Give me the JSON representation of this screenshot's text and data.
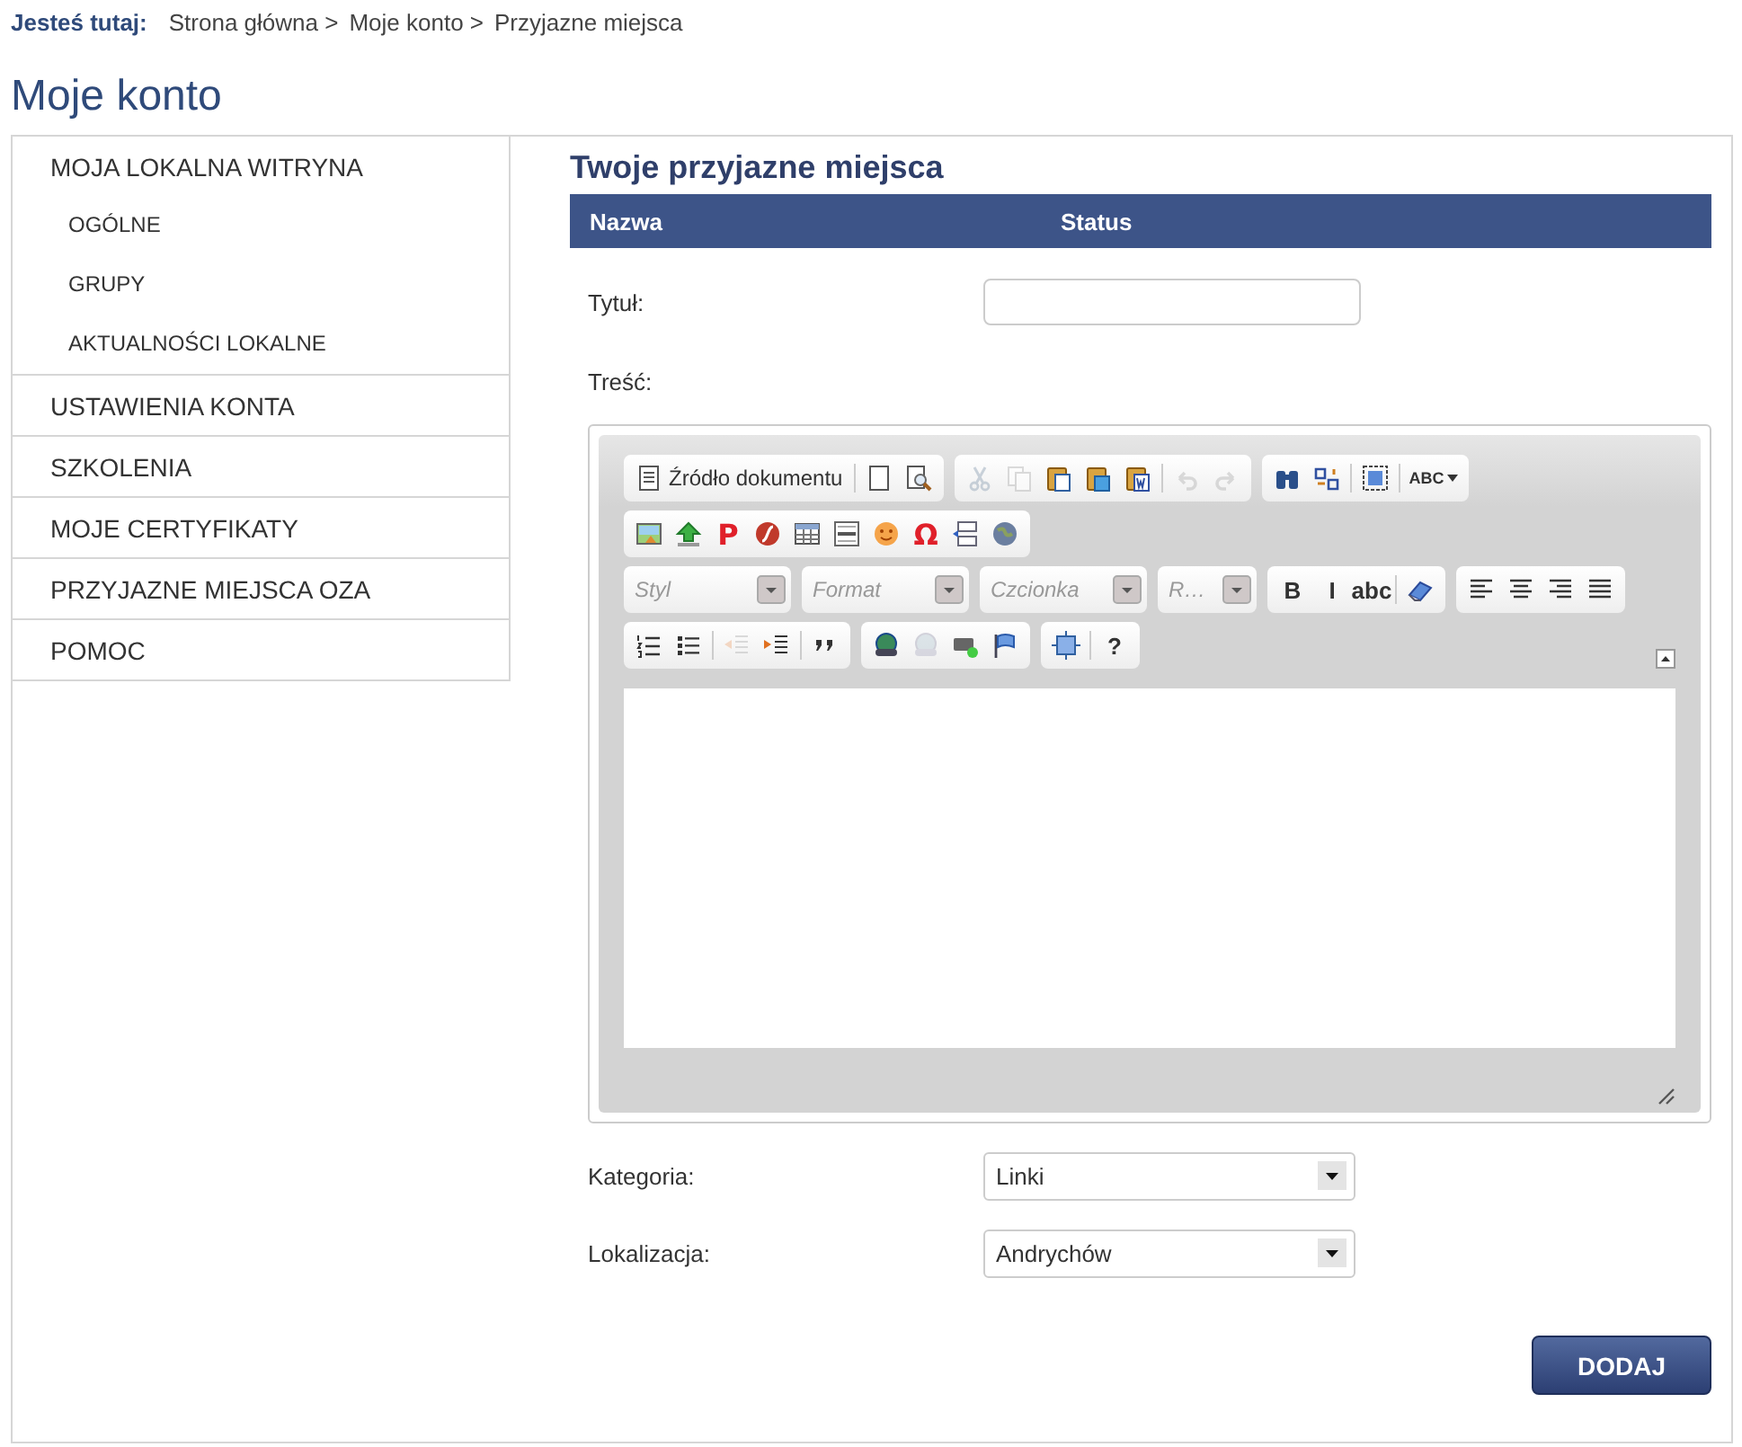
{
  "breadcrumb": {
    "label": "Jesteś tutaj:",
    "items": [
      "Strona główna >",
      "Moje konto >",
      "Przyjazne miejsca"
    ]
  },
  "page_title": "Moje konto",
  "sidebar": {
    "items": [
      {
        "label": "MOJA LOKALNA WITRYNA",
        "children": [
          {
            "label": "OGÓLNE"
          },
          {
            "label": "GRUPY"
          },
          {
            "label": "AKTUALNOŚCI LOKALNE"
          }
        ]
      },
      {
        "label": "USTAWIENIA KONTA"
      },
      {
        "label": "SZKOLENIA"
      },
      {
        "label": "MOJE CERTYFIKATY"
      },
      {
        "label": "PRZYJAZNE MIEJSCA OZA"
      },
      {
        "label": "POMOC"
      }
    ]
  },
  "section_title": "Twoje przyjazne miejsca",
  "table": {
    "columns": [
      "Nazwa",
      "Status"
    ]
  },
  "form": {
    "title_label": "Tytuł:",
    "content_label": "Treść:",
    "editor": {
      "toolbar_rows": [
        [
          {
            "items": [
              {
                "kind": "source",
                "label": "Źródło dokumentu"
              },
              {
                "kind": "separator"
              },
              {
                "kind": "button",
                "disabled": false
              },
              {
                "kind": "button",
                "disabled": false
              }
            ]
          },
          {
            "items": [
              {
                "kind": "button",
                "disabled": true
              },
              {
                "kind": "button",
                "disabled": true
              },
              {
                "kind": "button",
                "disabled": false
              },
              {
                "kind": "button",
                "disabled": false
              },
              {
                "kind": "button",
                "disabled": false
              },
              {
                "kind": "separator"
              },
              {
                "kind": "button",
                "disabled": true
              },
              {
                "kind": "button",
                "disabled": true
              }
            ]
          },
          {
            "items": [
              {
                "kind": "button",
                "disabled": false
              },
              {
                "kind": "button",
                "disabled": false
              },
              {
                "kind": "separator"
              },
              {
                "kind": "button",
                "disabled": false
              },
              {
                "kind": "separator"
              },
              {
                "kind": "dropdown",
                "glyph": "ABC"
              }
            ]
          }
        ],
        [
          {
            "items": [
              {
                "kind": "button",
                "disabled": false
              },
              {
                "kind": "button",
                "disabled": false
              },
              {
                "kind": "glyph",
                "glyph": "P"
              },
              {
                "kind": "button",
                "disabled": false
              },
              {
                "kind": "button",
                "disabled": false
              },
              {
                "kind": "button",
                "disabled": false
              },
              {
                "kind": "button",
                "disabled": false
              },
              {
                "kind": "glyph",
                "glyph": "Ω"
              },
              {
                "kind": "button",
                "disabled": false
              },
              {
                "kind": "button",
                "disabled": false
              }
            ]
          }
        ],
        [
          {
            "items": [
              {
                "kind": "combo",
                "placeholder": "Styl"
              }
            ]
          },
          {
            "items": [
              {
                "kind": "combo",
                "placeholder": "Format"
              }
            ]
          },
          {
            "items": [
              {
                "kind": "combo",
                "placeholder": "Czcionka"
              }
            ]
          },
          {
            "items": [
              {
                "kind": "combo",
                "placeholder": "R…"
              }
            ]
          },
          {
            "items": [
              {
                "kind": "glyph",
                "glyph": "B"
              },
              {
                "kind": "glyph",
                "glyph": "I"
              },
              {
                "kind": "glyph",
                "glyph": "abc"
              },
              {
                "kind": "separator"
              },
              {
                "kind": "button",
                "disabled": false
              }
            ]
          },
          {
            "items": [
              {
                "kind": "button",
                "disabled": false
              },
              {
                "kind": "button",
                "disabled": false
              },
              {
                "kind": "button",
                "disabled": false
              },
              {
                "kind": "button",
                "disabled": false
              }
            ]
          }
        ],
        [
          {
            "items": [
              {
                "kind": "button",
                "disabled": false
              },
              {
                "kind": "button",
                "disabled": false
              },
              {
                "kind": "separator"
              },
              {
                "kind": "button",
                "disabled": true
              },
              {
                "kind": "button",
                "disabled": false
              },
              {
                "kind": "separator"
              },
              {
                "kind": "button",
                "disabled": false
              }
            ]
          },
          {
            "items": [
              {
                "kind": "button",
                "disabled": false
              },
              {
                "kind": "button",
                "disabled": true
              },
              {
                "kind": "button",
                "disabled": false
              },
              {
                "kind": "button",
                "disabled": false
              }
            ]
          },
          {
            "items": [
              {
                "kind": "button",
                "disabled": false
              },
              {
                "kind": "separator"
              },
              {
                "kind": "glyph",
                "glyph": "?"
              }
            ]
          }
        ]
      ]
    },
    "category_label": "Kategoria:",
    "category_value": "Linki",
    "location_label": "Lokalizacja:",
    "location_value": "Andrychów",
    "submit": "DODAJ"
  }
}
